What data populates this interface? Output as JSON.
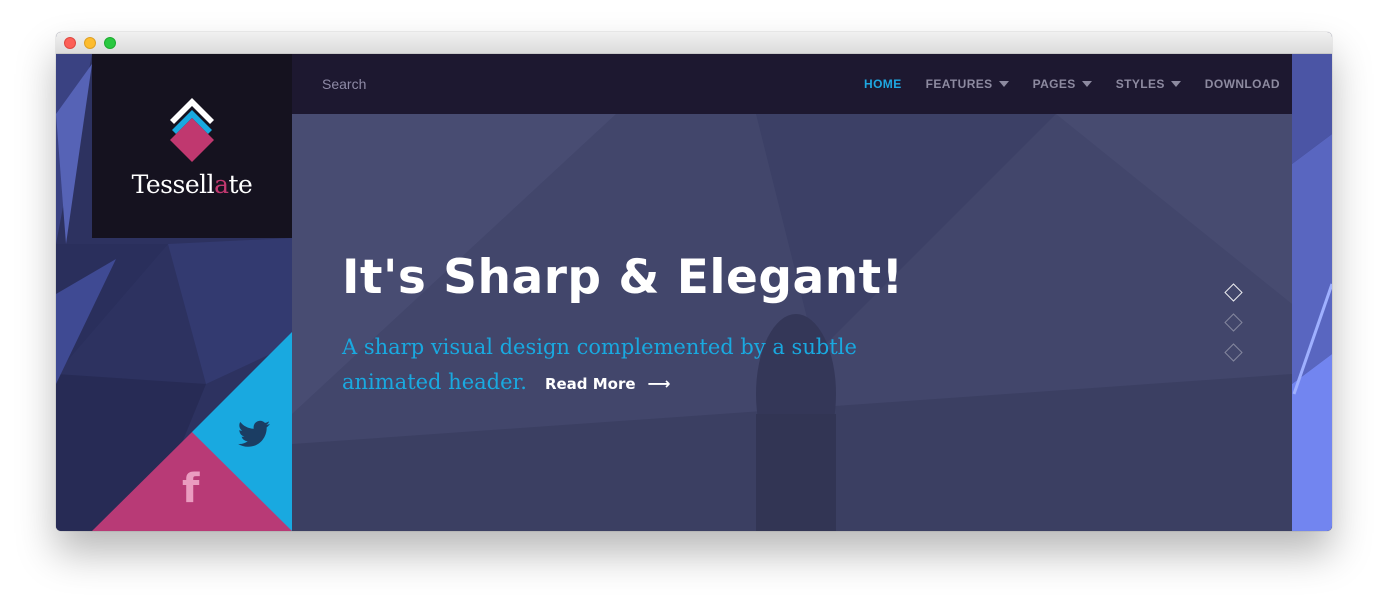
{
  "brand": {
    "name_pre": "Tessell",
    "name_accent": "a",
    "name_post": "te",
    "accent_color": "#c0386f"
  },
  "search": {
    "placeholder": "Search"
  },
  "nav": {
    "items": [
      {
        "label": "HOME",
        "active": true,
        "dropdown": false
      },
      {
        "label": "FEATURES",
        "active": false,
        "dropdown": true
      },
      {
        "label": "PAGES",
        "active": false,
        "dropdown": true
      },
      {
        "label": "STYLES",
        "active": false,
        "dropdown": true
      },
      {
        "label": "DOWNLOAD",
        "active": false,
        "dropdown": false
      }
    ],
    "active_color": "#1ea7e1"
  },
  "hero": {
    "title": "It's Sharp & Elegant!",
    "subtitle": "A sharp visual design complemented by a subtle animated header.",
    "read_more": "Read More",
    "arrow_icon": "arrow-right-icon",
    "subtitle_color": "#19a9e0"
  },
  "slider": {
    "count": 3,
    "active_index": 0
  },
  "social": {
    "twitter_icon": "twitter-icon",
    "facebook_glyph": "f",
    "twitter_color": "#19a9e0",
    "facebook_color": "#b83a76"
  }
}
